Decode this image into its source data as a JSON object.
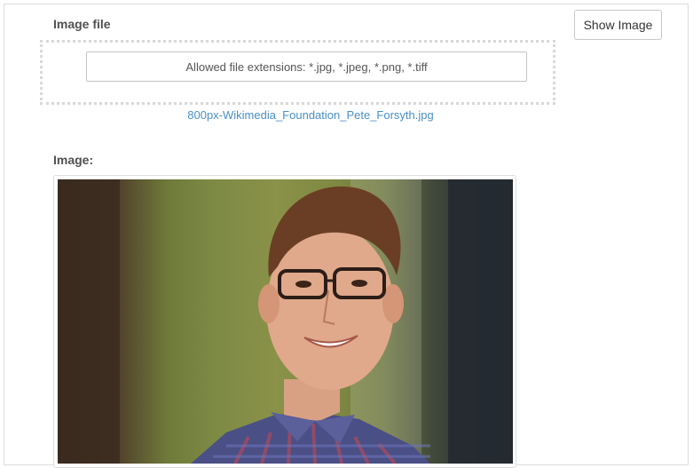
{
  "form": {
    "image_file_label": "Image file",
    "show_image_button": "Show Image",
    "file_input_hint": "Allowed file extensions: *.jpg, *.jpeg, *.png, *.tiff",
    "uploaded_file_name": "800px-Wikimedia_Foundation_Pete_Forsyth.jpg",
    "image_label": "Image:"
  },
  "icons": {
    "photo": "portrait-photo"
  },
  "colors": {
    "link": "#4a8fc7",
    "label": "#505050",
    "border": "#dcdcdc"
  }
}
